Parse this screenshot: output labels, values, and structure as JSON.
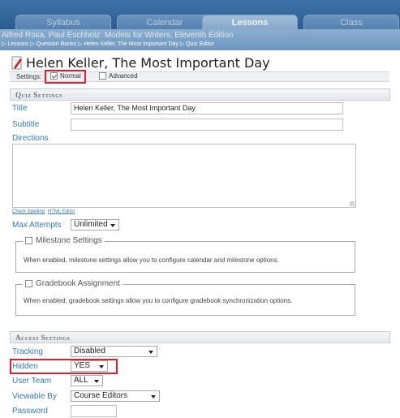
{
  "nav": {
    "tabs": [
      {
        "label": "Syllabus",
        "active": false
      },
      {
        "label": "Calendar",
        "active": false
      },
      {
        "label": "Lessons",
        "active": true
      },
      {
        "label": "Class",
        "active": false
      }
    ],
    "course_title": "Alfred Rosa, Paul Eschholz: Models for Writers, Eleventh Edition",
    "breadcrumb": "▷ Lessons ▷ Question Banks ▷ Helen Keller, The Most Important Day ▷ Quiz Editor"
  },
  "page": {
    "title": "Helen Keller, The Most Important Day",
    "title_icon": "document-edit-icon"
  },
  "settings": {
    "label": "Settings:",
    "normal_label": "Normal",
    "normal_checked": true,
    "advanced_label": "Advanced",
    "advanced_checked": false
  },
  "quiz_settings": {
    "header": "Quiz Settings",
    "title_label": "Title",
    "title_value": "Helen Keller, The Most Important Day",
    "subtitle_label": "Subtitle",
    "subtitle_value": "",
    "directions_label": "Directions",
    "directions_value": "",
    "check_spelling": "Check Spelling",
    "html_editor": "HTML Editor",
    "max_attempts_label": "Max Attempts",
    "max_attempts_value": "Unlimited"
  },
  "milestone": {
    "label": "Milestone Settings",
    "description": "When enabled, milestone settings allow you to configure calendar and milestone options."
  },
  "gradebook": {
    "label": "Gradebook Assignment",
    "description": "When enabled, gradebook settings allow you to configure gradebook synchronization options."
  },
  "access_settings": {
    "header": "Access Settings",
    "tracking_label": "Tracking",
    "tracking_value": "Disabled",
    "hidden_label": "Hidden",
    "hidden_value": "YES",
    "user_team_label": "User Team",
    "user_team_value": "ALL",
    "viewable_by_label": "Viewable By",
    "viewable_by_value": "Course Editors",
    "password_label": "Password",
    "password_value": ""
  },
  "colors": {
    "nav_bg": "#2b5c8f",
    "label_blue": "#3a78b5",
    "highlight_red": "#d9232e"
  }
}
